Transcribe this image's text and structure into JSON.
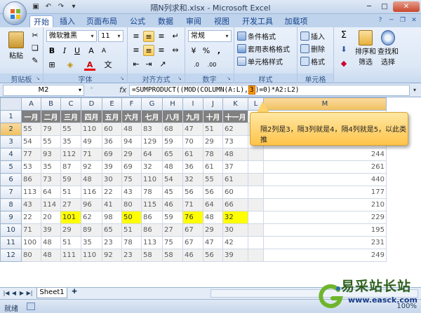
{
  "window": {
    "title": "隔N列求和.xlsx - Microsoft Excel"
  },
  "qat": [
    "save-icon",
    "undo-icon",
    "redo-icon",
    "customize-icon"
  ],
  "ribbon": {
    "tabs": [
      "开始",
      "插入",
      "页面布局",
      "公式",
      "数据",
      "审阅",
      "视图",
      "开发工具",
      "加载项"
    ],
    "active_tab": "开始",
    "clipboard": {
      "paste": "粘贴",
      "group": "剪贴板"
    },
    "font": {
      "name": "微软雅黑",
      "size": "11",
      "group": "字体"
    },
    "alignment": {
      "group": "对齐方式"
    },
    "number": {
      "format": "常规",
      "group": "数字"
    },
    "styles": {
      "cond": "条件格式",
      "table": "套用表格格式",
      "cell": "单元格样式",
      "group": "样式"
    },
    "cells": {
      "insert": "插入",
      "delete": "删除",
      "format": "格式",
      "group": "单元格"
    },
    "editing": {
      "sort": "排序和",
      "sort2": "筛选",
      "find": "查找和",
      "find2": "选择",
      "sigma": "Σ"
    }
  },
  "formula_bar": {
    "name_box": "M2",
    "fx": "fx",
    "formula_before": "=SUMPRODUCT((MOD(COLUMN(A:L),",
    "formula_highlight": "3",
    "formula_after": ")=0)*A2:L2)"
  },
  "sheet": {
    "columns": [
      "A",
      "B",
      "C",
      "D",
      "E",
      "F",
      "G",
      "H",
      "I",
      "J",
      "K",
      "L",
      "M"
    ],
    "header_row": [
      "一月",
      "二月",
      "三月",
      "四月",
      "五月",
      "六月",
      "七月",
      "八月",
      "九月",
      "十月",
      "十一月",
      "",
      ""
    ],
    "rows": [
      [
        "55",
        "79",
        "55",
        "110",
        "60",
        "48",
        "83",
        "68",
        "47",
        "51",
        "62",
        "",
        ""
      ],
      [
        "54",
        "55",
        "35",
        "49",
        "36",
        "94",
        "129",
        "59",
        "70",
        "29",
        "73",
        "",
        ""
      ],
      [
        "77",
        "93",
        "112",
        "71",
        "69",
        "29",
        "64",
        "65",
        "61",
        "78",
        "48",
        "",
        "244"
      ],
      [
        "53",
        "35",
        "87",
        "92",
        "39",
        "69",
        "32",
        "48",
        "36",
        "61",
        "37",
        "",
        "261"
      ],
      [
        "86",
        "73",
        "59",
        "48",
        "30",
        "75",
        "110",
        "54",
        "32",
        "55",
        "61",
        "",
        "440"
      ],
      [
        "113",
        "64",
        "51",
        "116",
        "22",
        "43",
        "78",
        "45",
        "56",
        "56",
        "60",
        "",
        "177"
      ],
      [
        "43",
        "114",
        "27",
        "96",
        "41",
        "80",
        "115",
        "46",
        "71",
        "64",
        "66",
        "",
        "210"
      ],
      [
        "22",
        "20",
        "101",
        "62",
        "98",
        "50",
        "86",
        "59",
        "76",
        "48",
        "32",
        "",
        "229"
      ],
      [
        "71",
        "39",
        "29",
        "89",
        "65",
        "51",
        "86",
        "27",
        "67",
        "29",
        "30",
        "",
        "195"
      ],
      [
        "100",
        "48",
        "51",
        "35",
        "23",
        "78",
        "113",
        "75",
        "67",
        "47",
        "42",
        "",
        "231"
      ],
      [
        "80",
        "48",
        "111",
        "110",
        "92",
        "23",
        "58",
        "58",
        "46",
        "56",
        "39",
        "",
        "249"
      ]
    ],
    "row_numbers": [
      "1",
      "2",
      "3",
      "4",
      "5",
      "6",
      "7",
      "8",
      "9",
      "10",
      "11",
      "12"
    ],
    "highlight_row": 8,
    "highlight_cols": [
      2,
      5,
      8,
      10
    ],
    "active_column": "M",
    "active_row": "2"
  },
  "callout": {
    "text": "隔2列是3，隔3列就是4，隔4列就是5，以此类推"
  },
  "sheet_tabs": {
    "active": "Sheet1"
  },
  "status": {
    "ready": "就绪",
    "zoom": "100%"
  },
  "watermark": {
    "title": "易采站长站",
    "url": "www.easck.com",
    "logo": "easck-logo-icon"
  },
  "colors": {
    "header_fill": "#808080",
    "highlight": "#ffff00",
    "callout": "#ffc44a",
    "formula_highlight": "#ff9900"
  }
}
